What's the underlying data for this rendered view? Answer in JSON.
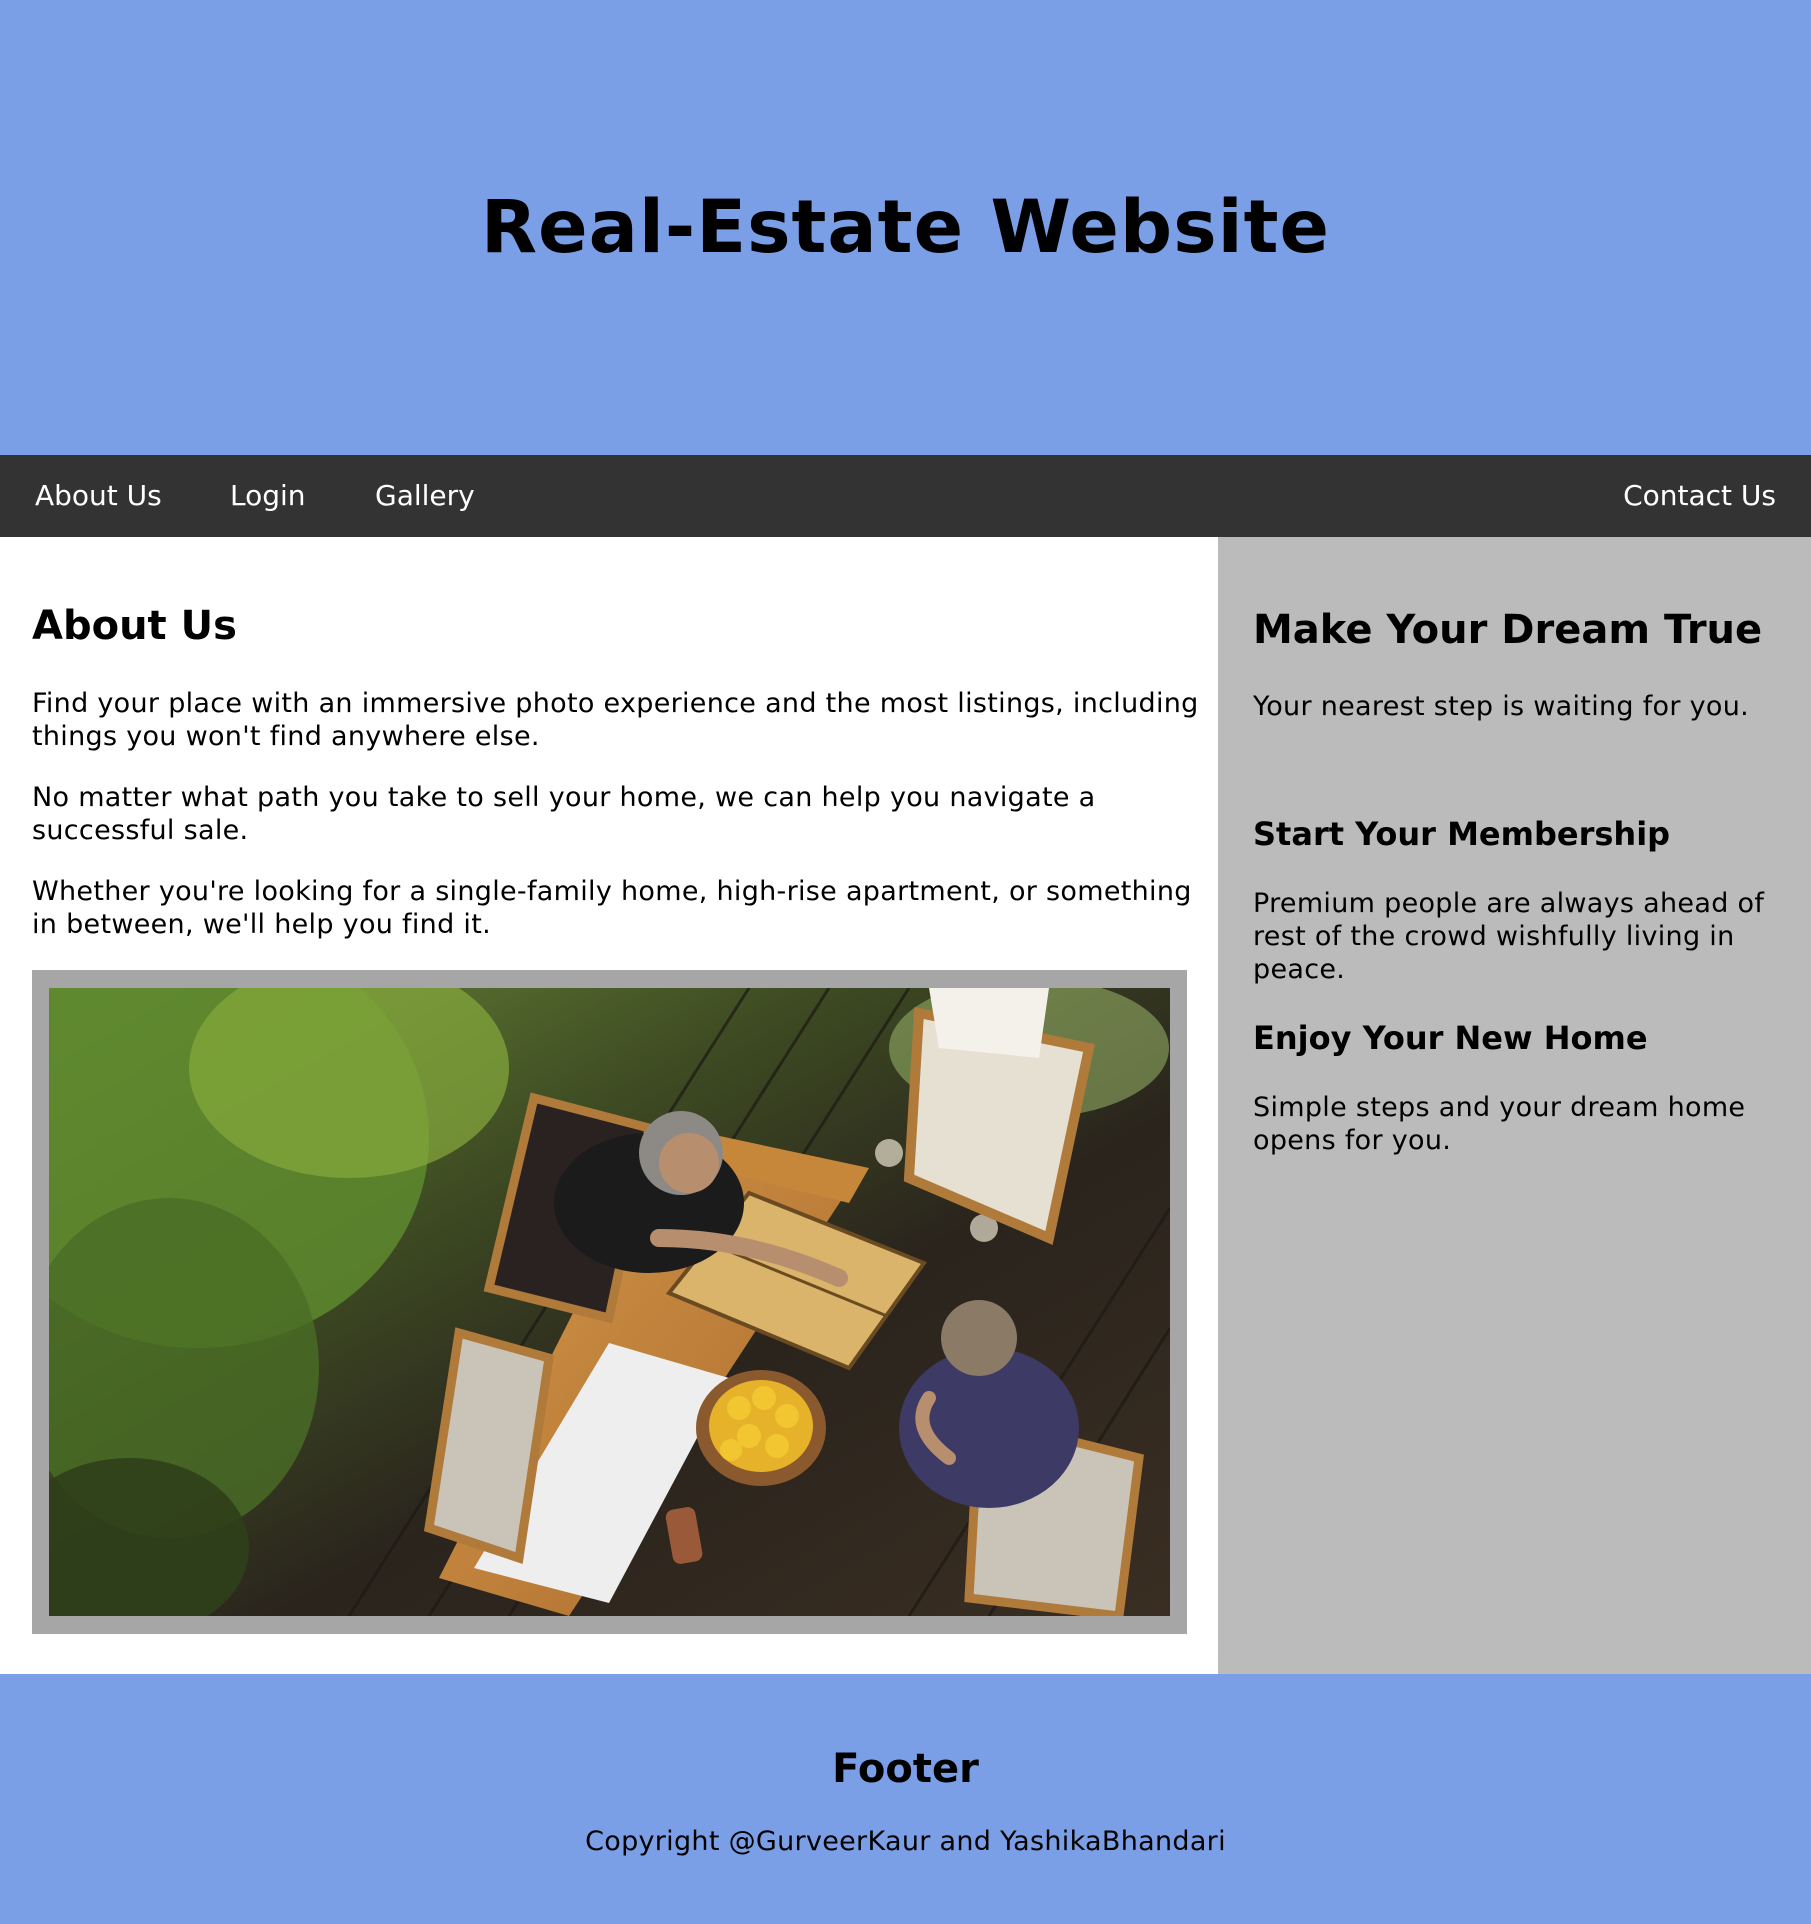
{
  "header": {
    "title": "Real-Estate Website"
  },
  "nav": {
    "items": [
      {
        "label": "About Us"
      },
      {
        "label": "Login"
      },
      {
        "label": "Gallery"
      },
      {
        "label": "Contact Us"
      }
    ]
  },
  "main": {
    "heading": "About Us",
    "paragraphs": [
      "Find your place with an immersive photo experience and the most listings, including things you won't find anywhere else.",
      "No matter what path you take to sell your home, we can help you navigate a successful sale.",
      "Whether you're looking for a single-family home, high-rise apartment, or something in between, we'll help you find it."
    ]
  },
  "sidebar": {
    "heading": "Make Your Dream True",
    "subtext": "Your nearest step is waiting for you.",
    "sections": [
      {
        "title": "Start Your Membership",
        "text": "Premium people are always ahead of rest of the crowd wishfully living in peace."
      },
      {
        "title": "Enjoy Your New Home",
        "text": "Simple steps and your dream home opens for you."
      }
    ]
  },
  "footer": {
    "heading": "Footer",
    "copyright": "Copyright @GurveerKaur and YashikaBhandari"
  },
  "colors": {
    "header_bg": "#7a9fe6",
    "nav_bg": "#333333",
    "sidebar_bg": "#bbbbbb",
    "footer_bg": "#7a9fe6",
    "photo_frame": "#a6a6a6"
  }
}
